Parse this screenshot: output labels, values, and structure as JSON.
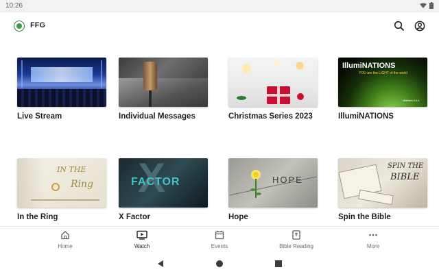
{
  "status": {
    "time": "10:26"
  },
  "header": {
    "title": "FFG"
  },
  "cards": [
    {
      "label": "Live Stream"
    },
    {
      "label": "Individual Messages"
    },
    {
      "label": "Christmas Series 2023"
    },
    {
      "label": "IllumiNATIONS",
      "thumb_title": "IllumiNATIONS",
      "thumb_subtitle": "YOU are the LIGHT of the world",
      "thumb_verse": "Matthew 5:14"
    },
    {
      "label": "In the Ring",
      "thumb_title_1": "IN THE",
      "thumb_title_2": "Ring"
    },
    {
      "label": "X Factor",
      "thumb_title": "FACTOR",
      "thumb_letter": "X"
    },
    {
      "label": "Hope",
      "thumb_title": "HOPE"
    },
    {
      "label": "Spin the Bible",
      "thumb_title_1": "SPIN THE",
      "thumb_title_2": "BIBLE"
    }
  ],
  "bottom_nav": [
    {
      "label": "Home",
      "icon": "home-icon"
    },
    {
      "label": "Watch",
      "icon": "watch-icon"
    },
    {
      "label": "Events",
      "icon": "calendar-icon"
    },
    {
      "label": "Bible Reading",
      "icon": "bible-icon"
    },
    {
      "label": "More",
      "icon": "more-icon"
    }
  ],
  "colors": {
    "brand_green": "#3a9a46",
    "active_nav": "#1f1f1f",
    "inactive_nav": "#6b6b6b"
  }
}
